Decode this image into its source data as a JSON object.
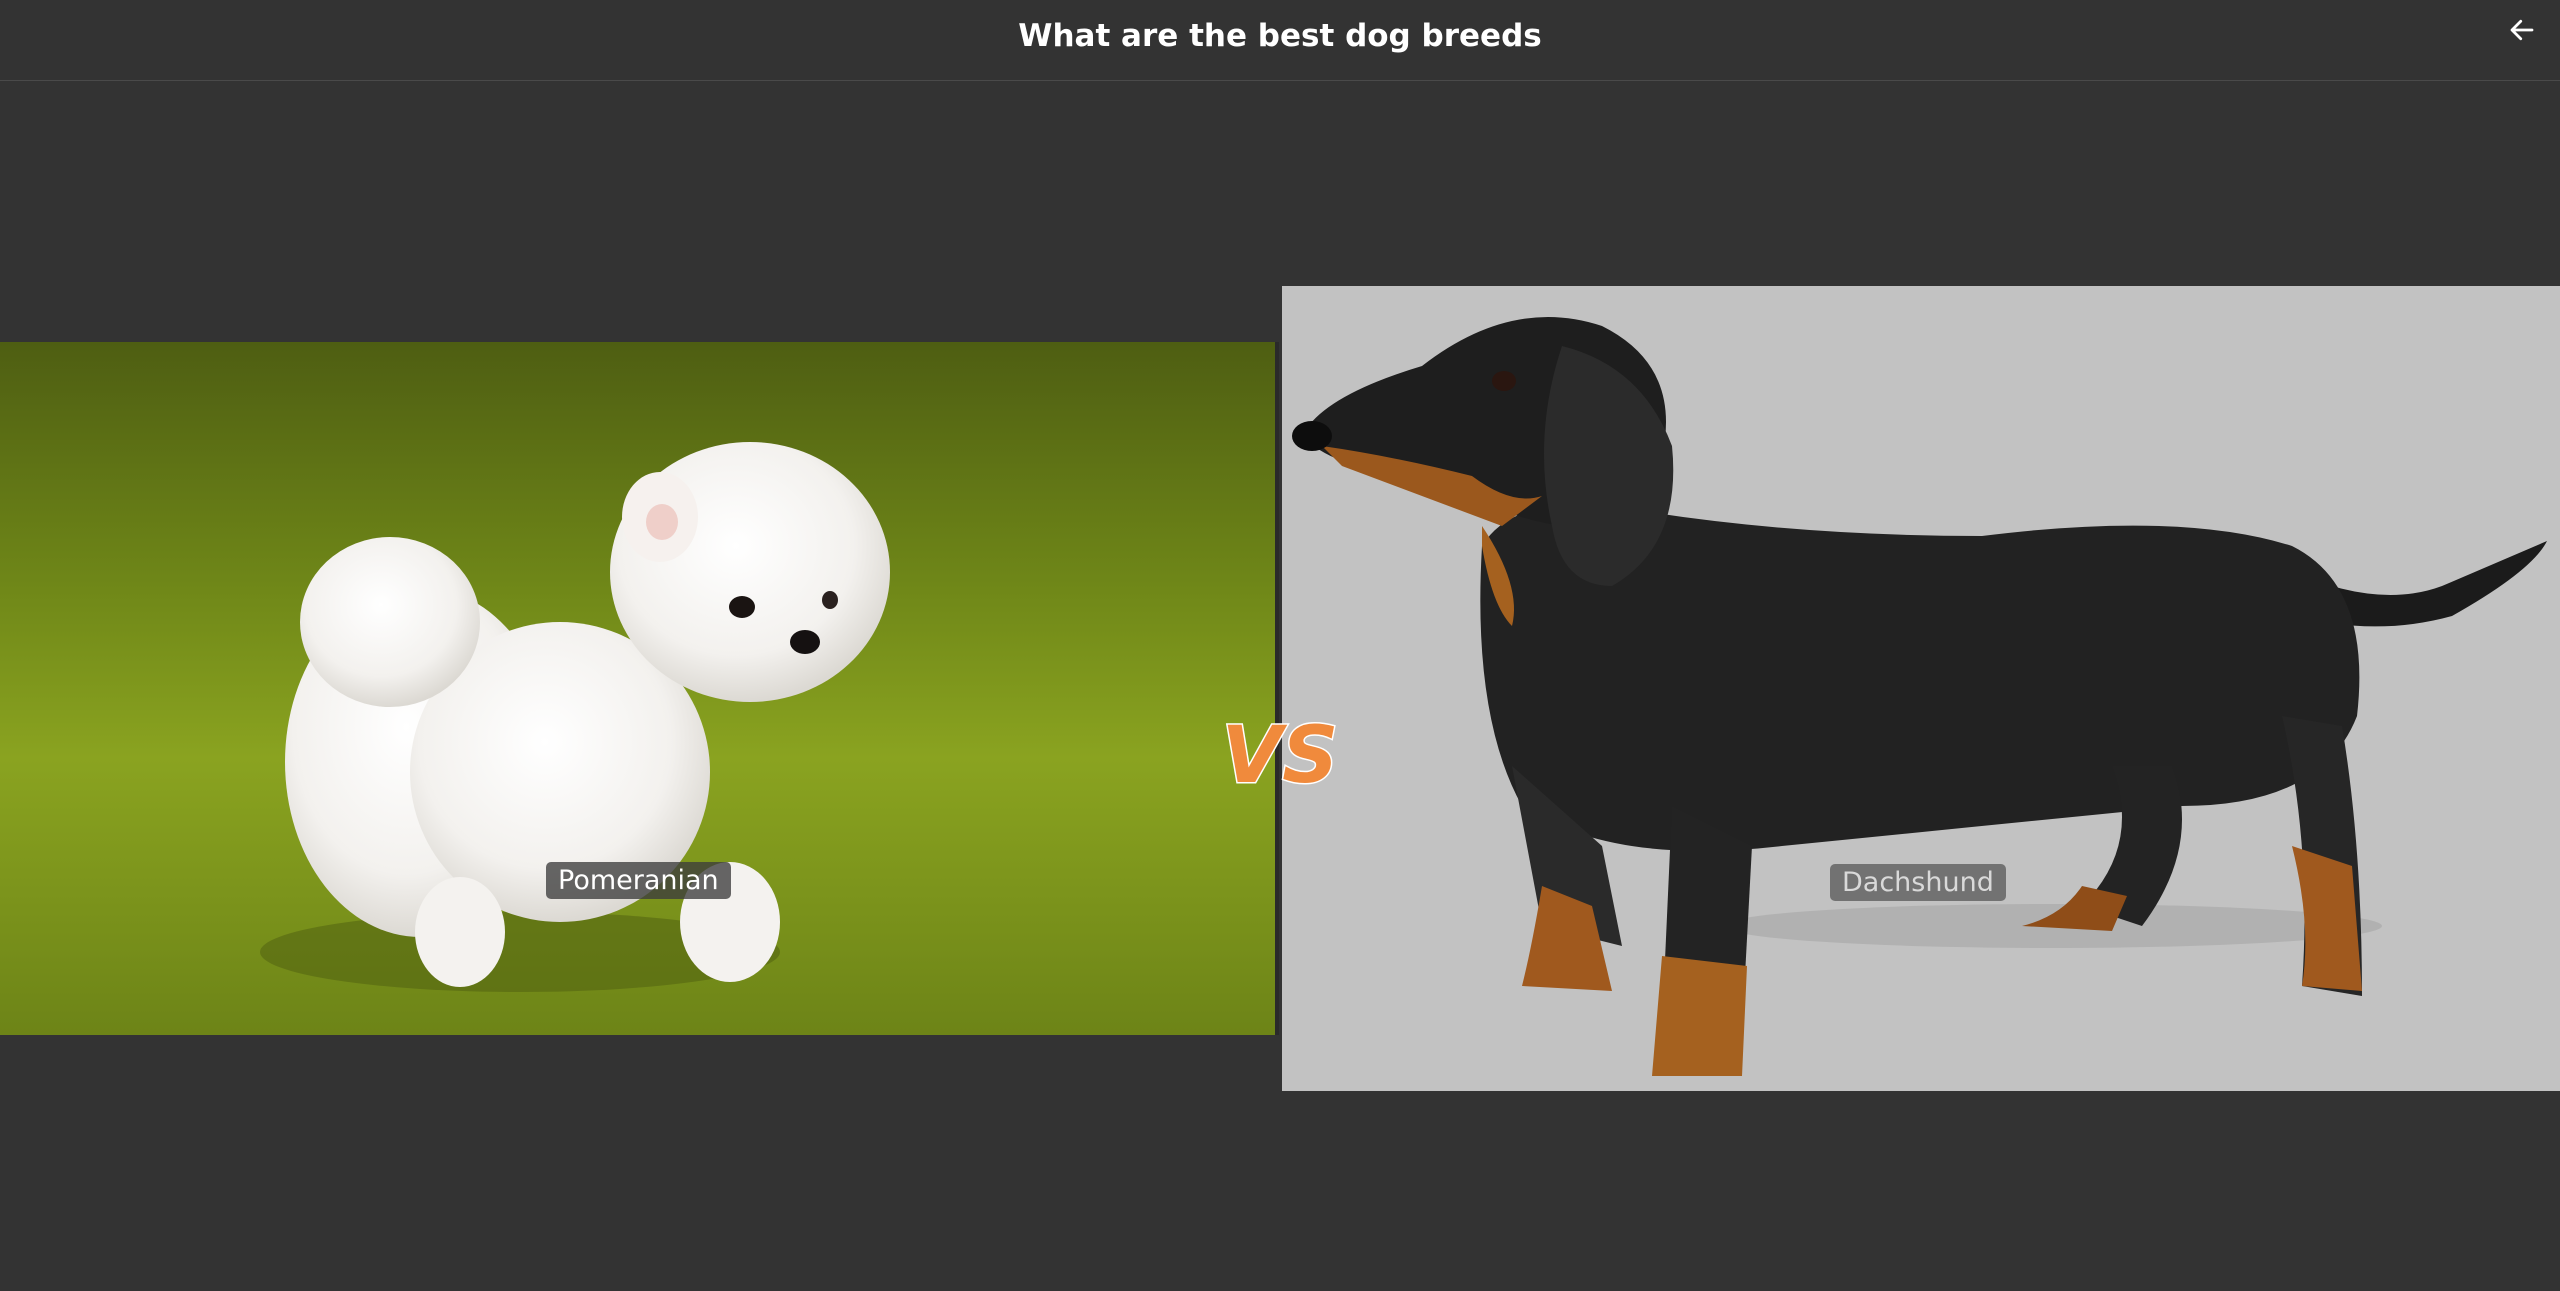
{
  "header": {
    "title": "What are the best dog breeds",
    "back_icon": "arrow-left-icon"
  },
  "matchup": {
    "left": {
      "name": "Pomeranian"
    },
    "vs_label": "VS",
    "right": {
      "name": "Dachshund"
    }
  },
  "colors": {
    "background": "#333333",
    "vs_fill": "#f08a3c",
    "left_image_bg": "#7a8f1f",
    "right_image_bg": "#c2c2c2"
  }
}
